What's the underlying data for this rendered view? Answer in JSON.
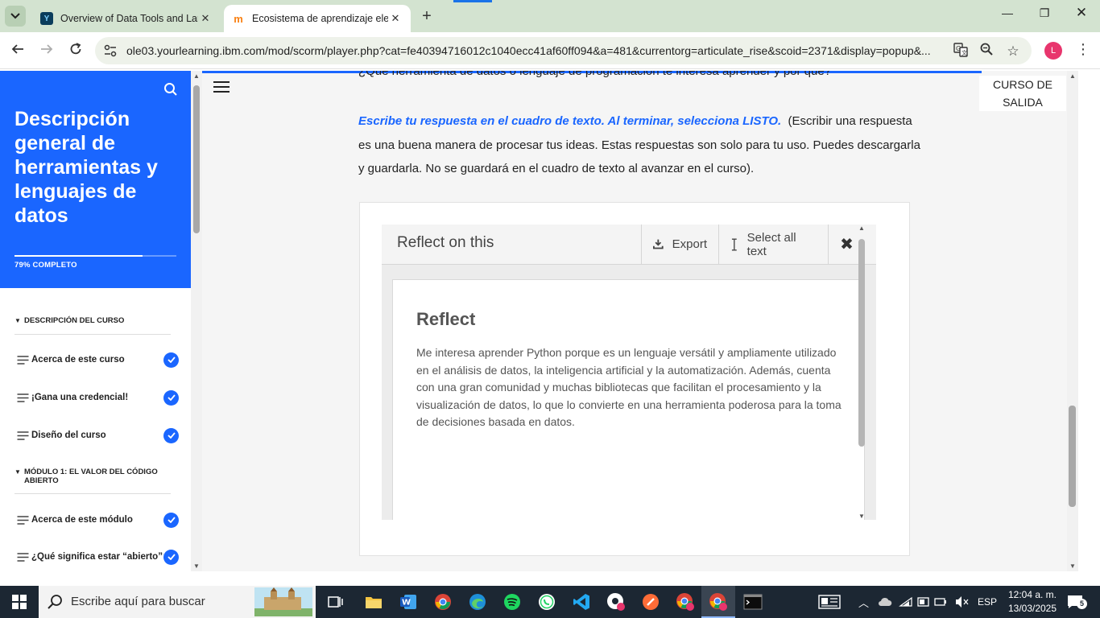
{
  "browser": {
    "tabs": [
      {
        "title": "Overview of Data Tools and Lan",
        "active": false
      },
      {
        "title": "Ecosistema de aprendizaje elect",
        "active": true
      }
    ],
    "url": "ole03.yourlearning.ibm.com/mod/scorm/player.php?cat=fe40394716012c1040ecc41af60ff094&a=481&currentorg=articulate_rise&scoid=2371&display=popup&...",
    "profile_initial": "L",
    "accent_color": "#1a73e8"
  },
  "sidebar": {
    "course_title": "Descripción general de herramientas y lenguajes de datos",
    "progress_label": "79% COMPLETO",
    "progress_fraction": 0.79,
    "brand_color": "#1a66ff",
    "sections": [
      {
        "title": "DESCRIPCIÓN DEL CURSO",
        "items": [
          "Acerca de este curso",
          "¡Gana una credencial!",
          "Diseño del curso"
        ]
      },
      {
        "title": "MÓDULO 1: EL VALOR DEL CÓDIGO ABIERTO",
        "items": [
          "Acerca de este módulo",
          "¿Qué significa estar “abierto”?"
        ]
      }
    ]
  },
  "main": {
    "cut_question": "¿Qué herramienta de datos o lenguaje de programación te interesa aprender y por qué?",
    "exit_button": "CURSO DE SALIDA",
    "instruction_em": "Escribe tu respuesta en el cuadro de texto. Al terminar, selecciona LISTO.",
    "instruction_rest": "(Escribir una respuesta es una buena manera de procesar tus ideas. Estas respuestas son solo para tu uso. Puedes descargarla y guardarla. No se guardará en el cuadro de texto al avanzar en el curso).",
    "reflect": {
      "panel_title": "Reflect on this",
      "export_label": "Export",
      "select_all_label": "Select all text",
      "doc_title": "Reflect",
      "doc_body": "Me interesa aprender Python porque es un lenguaje versátil y ampliamente utilizado en el análisis de datos, la inteligencia artificial y la automatización. Además, cuenta con una gran comunidad y muchas bibliotecas que facilitan el procesamiento y la visualización de datos, lo que lo convierte en una herramienta poderosa para la toma de decisiones basada en datos."
    }
  },
  "taskbar": {
    "search_placeholder": "Escribe aquí para buscar",
    "language": "ESP",
    "time": "12:04 a. m.",
    "date": "13/03/2025",
    "notification_count": "5"
  }
}
